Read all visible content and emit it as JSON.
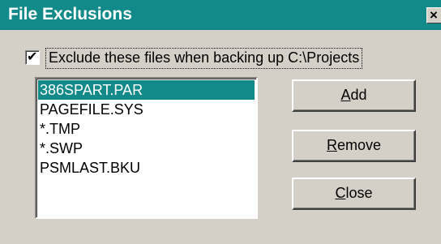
{
  "window": {
    "title": "File Exclusions",
    "close_glyph": "×",
    "colors": {
      "titlebar": "#138a8a",
      "face": "#d4d0c8",
      "selection": "#138a8a"
    }
  },
  "exclude_option": {
    "checked": true,
    "label": "Exclude these files when backing up C:\\Projects"
  },
  "file_list": {
    "items": [
      "386SPART.PAR",
      "PAGEFILE.SYS",
      "*.TMP",
      "*.SWP",
      "PSMLAST.BKU"
    ],
    "selected_index": 0
  },
  "buttons": {
    "add": {
      "mnemonic": "A",
      "rest": "dd"
    },
    "remove": {
      "mnemonic": "R",
      "rest": "emove"
    },
    "close": {
      "mnemonic": "C",
      "rest": "lose"
    }
  }
}
